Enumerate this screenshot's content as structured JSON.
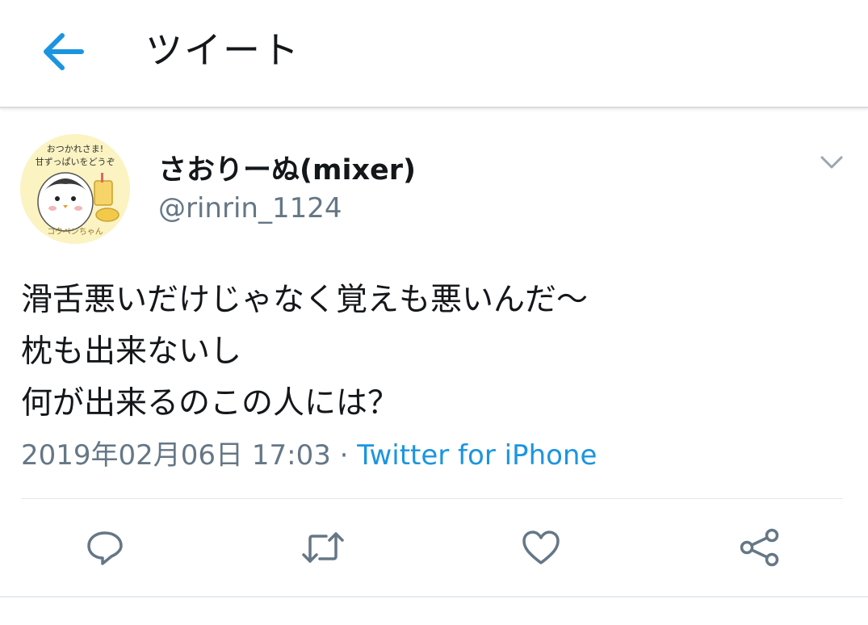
{
  "header": {
    "title": "ツイート",
    "back_icon": "arrow-left-icon"
  },
  "tweet": {
    "author": {
      "display_name": "さおりーぬ(mixer)",
      "handle": "@rinrin_1124",
      "avatar_text_line1": "おつかれさま!",
      "avatar_text_line2": "甘ずっぱいをどうぞ",
      "avatar_text_line3": "コウペンちゃん"
    },
    "text_lines": [
      "滑舌悪いだけじゃなく覚えも悪いんだ〜",
      "枕も出来ないし",
      "何が出来るのこの人には？"
    ],
    "timestamp": "2019年02月06日 17:03",
    "separator": "·",
    "source": "Twitter for iPhone"
  },
  "actions": [
    {
      "icon": "reply-icon"
    },
    {
      "icon": "retweet-icon"
    },
    {
      "icon": "like-icon"
    },
    {
      "icon": "share-icon"
    }
  ],
  "colors": {
    "accent": "#1b95e0",
    "secondary_text": "#657786",
    "primary_text": "#14171a",
    "divider": "#e1e8ed"
  }
}
